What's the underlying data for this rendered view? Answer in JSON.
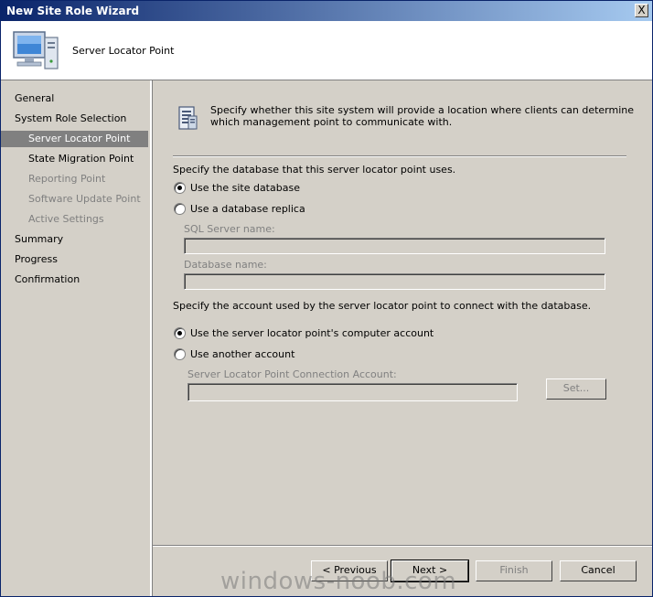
{
  "window": {
    "title": "New Site Role Wizard",
    "close_label": "X"
  },
  "header": {
    "title": "Server Locator Point",
    "icon": "computer-icon"
  },
  "nav": {
    "items": [
      {
        "label": "General",
        "state": "normal"
      },
      {
        "label": "System Role Selection",
        "state": "normal"
      },
      {
        "label": "Server Locator Point",
        "state": "selected"
      },
      {
        "label": "State Migration Point",
        "state": "normal"
      },
      {
        "label": "Reporting Point",
        "state": "disabled"
      },
      {
        "label": "Software Update Point",
        "state": "disabled"
      },
      {
        "label": "Active Settings",
        "state": "disabled"
      },
      {
        "label": "Summary",
        "state": "normal"
      },
      {
        "label": "Progress",
        "state": "normal"
      },
      {
        "label": "Confirmation",
        "state": "normal"
      }
    ]
  },
  "main": {
    "description": "Specify whether this site system will provide a location where clients can determine which management point to communicate with.",
    "db_prompt": "Specify the database that this server locator point uses.",
    "db_options": [
      {
        "label": "Use the site database",
        "selected": true
      },
      {
        "label": "Use a database replica",
        "selected": false
      }
    ],
    "sql_server_label": "SQL Server name:",
    "sql_server_value": "",
    "database_label": "Database name:",
    "database_value": "",
    "account_prompt": "Specify the account used by the server locator point to connect with the database.",
    "account_options": [
      {
        "label": "Use the server locator point's computer account",
        "selected": true
      },
      {
        "label": "Use another account",
        "selected": false
      }
    ],
    "connection_account_label": "Server Locator Point Connection Account:",
    "connection_account_value": "",
    "set_label": "Set..."
  },
  "footer": {
    "previous_label": "< Previous",
    "next_label": "Next >",
    "finish_label": "Finish",
    "cancel_label": "Cancel"
  },
  "watermark": "windows-noob.com"
}
